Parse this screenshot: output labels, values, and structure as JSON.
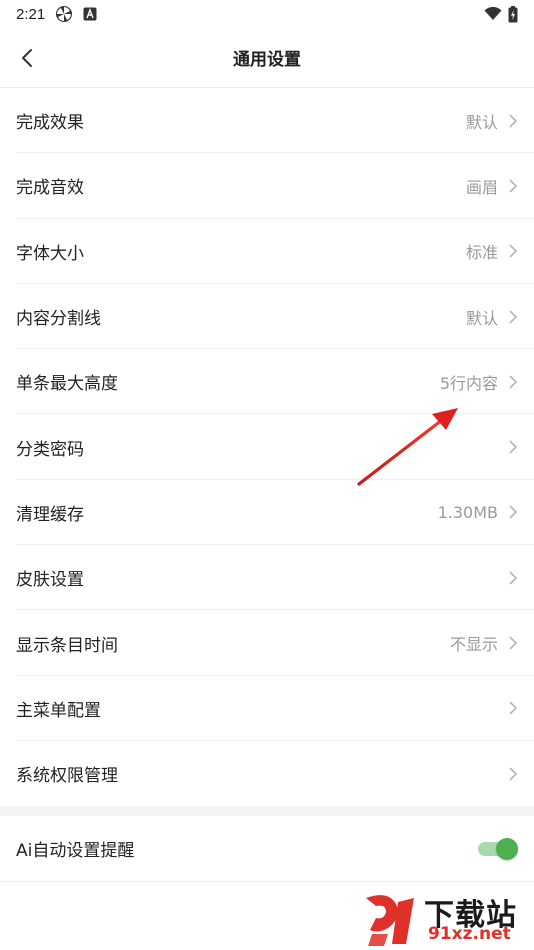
{
  "status_bar": {
    "time": "2:21"
  },
  "header": {
    "title": "通用设置"
  },
  "settings": [
    {
      "label": "完成效果",
      "value": "默认"
    },
    {
      "label": "完成音效",
      "value": "画眉"
    },
    {
      "label": "字体大小",
      "value": "标准"
    },
    {
      "label": "内容分割线",
      "value": "默认"
    },
    {
      "label": "单条最大高度",
      "value": "5行内容"
    },
    {
      "label": "分类密码",
      "value": ""
    },
    {
      "label": "清理缓存",
      "value": "1.30MB"
    },
    {
      "label": "皮肤设置",
      "value": ""
    },
    {
      "label": "显示条目时间",
      "value": "不显示"
    },
    {
      "label": "主菜单配置",
      "value": ""
    },
    {
      "label": "系统权限管理",
      "value": ""
    }
  ],
  "toggle_setting": {
    "label": "Ai自动设置提醒",
    "enabled": true
  },
  "watermark": {
    "brand": "下载站",
    "url": "91xz.net"
  },
  "colors": {
    "accent_green": "#4caf50",
    "annotation_red": "#e02020"
  }
}
